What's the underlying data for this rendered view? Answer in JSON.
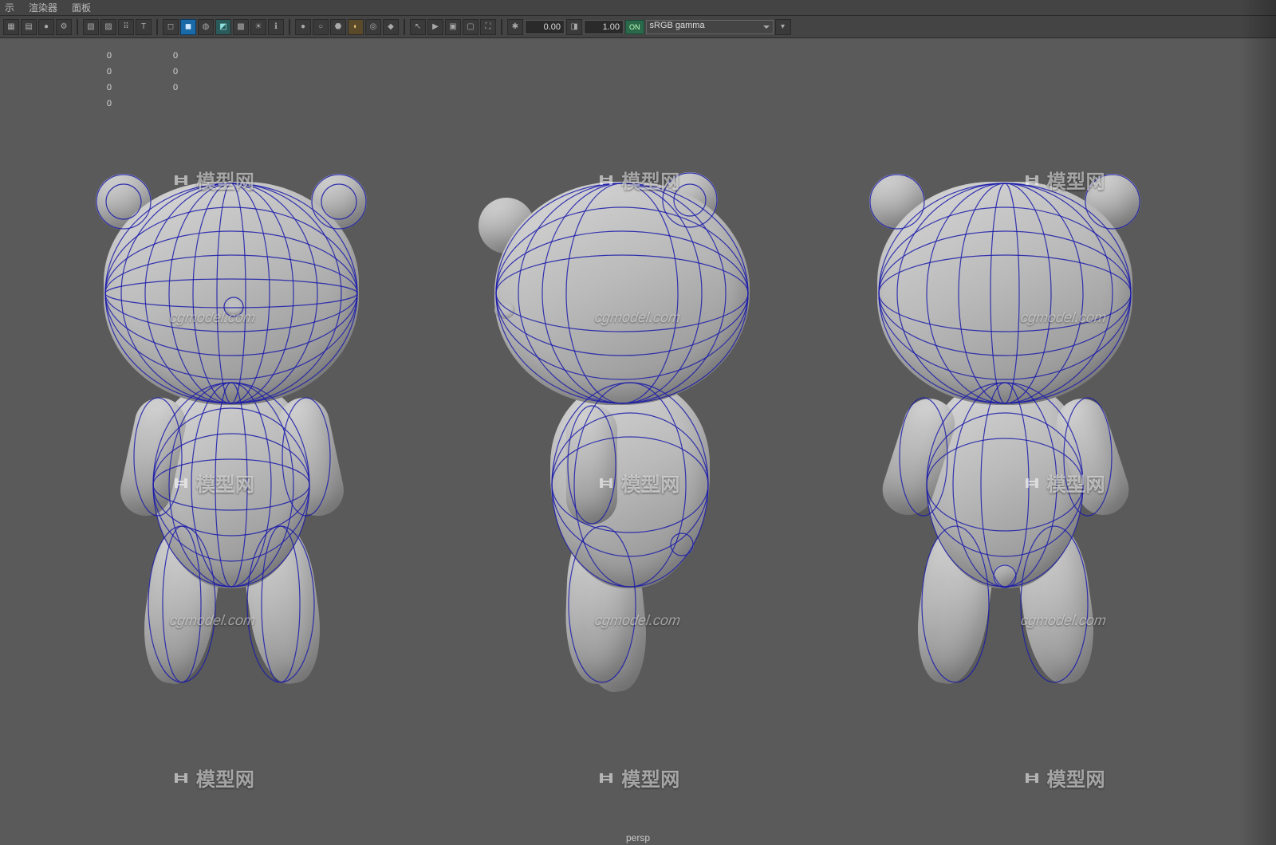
{
  "menu": {
    "m0": "示",
    "m1": "渲染器",
    "m2": "面板"
  },
  "toolbar": {
    "num_a": "0.00",
    "num_b": "1.00",
    "cm_toggle": "ON",
    "cm_select": "sRGB gamma"
  },
  "channels": {
    "col1": [
      "0",
      "0",
      "0",
      "0"
    ],
    "col2": [
      "0",
      "0",
      "0",
      ""
    ]
  },
  "watermark": {
    "brand": "模型网",
    "url": "cgmodel.com"
  },
  "camera": "persp"
}
